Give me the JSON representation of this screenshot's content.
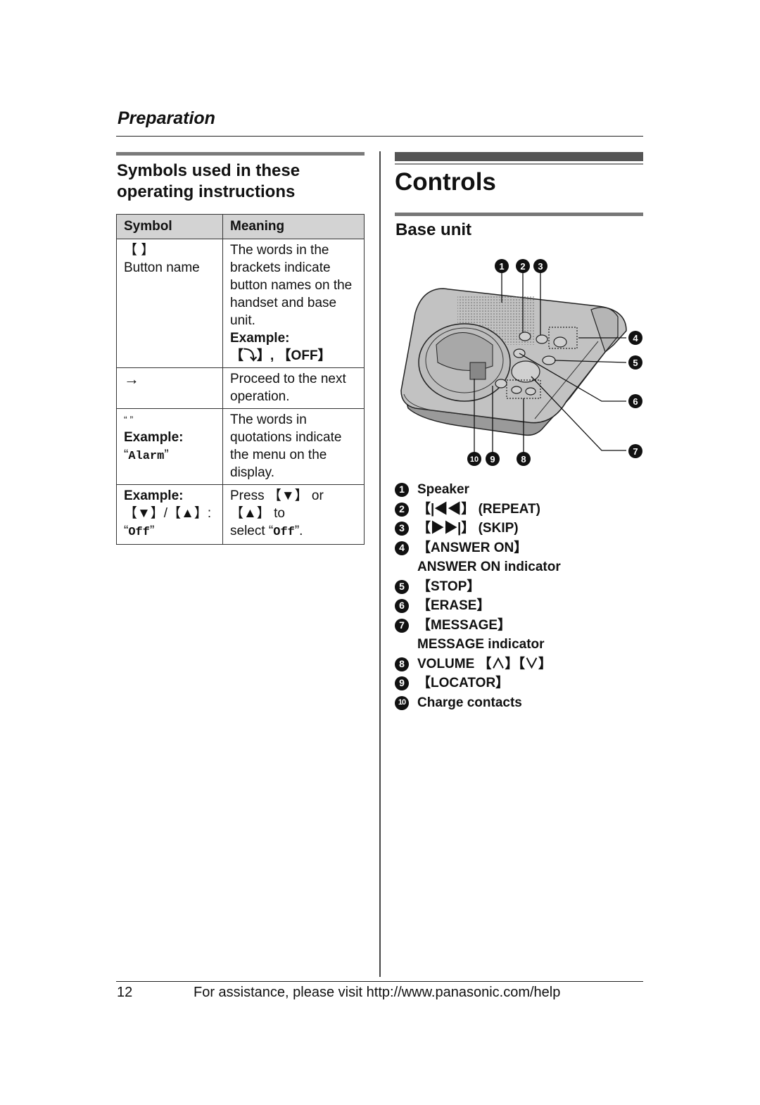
{
  "header": {
    "section_title": "Preparation"
  },
  "left": {
    "heading": "Symbols used in these operating instructions",
    "table": {
      "columns": [
        "Symbol",
        "Meaning"
      ],
      "rows": [
        {
          "symbol_lines": [
            "【 】",
            "Button name"
          ],
          "meaning_lines": [
            "The words in the",
            "brackets indicate",
            "button names on the",
            "handset and base",
            "unit."
          ],
          "example_label": "Example:",
          "example_value": "【⤵】, 【OFF】"
        },
        {
          "symbol": "→",
          "meaning_lines": [
            "Proceed to the next",
            "operation."
          ]
        },
        {
          "symbol": "“ ”",
          "symbol_example_label": "Example:",
          "symbol_example_value": "Alarm",
          "meaning_lines": [
            "The words in",
            "quotations indicate",
            "the menu on the",
            "display."
          ]
        },
        {
          "symbol_example_label": "Example:",
          "symbol_prefix": "【▼】/【▲】: “",
          "symbol_value": "Off",
          "symbol_suffix": "”",
          "meaning_prefix": "Press 【▼】 or 【▲】 to",
          "meaning_line2_prefix": "select “",
          "meaning_value": "Off",
          "meaning_line2_suffix": "”."
        }
      ]
    }
  },
  "right": {
    "heading": "Controls",
    "subheading": "Base unit",
    "figure": {
      "callouts": [
        "1",
        "2",
        "3",
        "4",
        "5",
        "6",
        "7",
        "8",
        "9",
        "10"
      ],
      "device_labels": {
        "repeat": "REPEAT",
        "skip": "SKIP",
        "erase": "ERASE",
        "stop": "STOP",
        "message": "MESSAGE",
        "locator": "LOCATOR",
        "volume": "VOLUME",
        "answer_on": "ANSWER ON"
      }
    },
    "legend": [
      {
        "num": "1",
        "lines": [
          "Speaker"
        ]
      },
      {
        "num": "2",
        "lines": [
          "【|◀◀】 (REPEAT)"
        ]
      },
      {
        "num": "3",
        "lines": [
          "【▶▶|】 (SKIP)"
        ]
      },
      {
        "num": "4",
        "lines": [
          "【ANSWER ON】",
          "ANSWER ON indicator"
        ]
      },
      {
        "num": "5",
        "lines": [
          "【STOP】"
        ]
      },
      {
        "num": "6",
        "lines": [
          "【ERASE】"
        ]
      },
      {
        "num": "7",
        "lines": [
          "【MESSAGE】",
          "MESSAGE indicator"
        ]
      },
      {
        "num": "8",
        "lines": [
          "VOLUME 【∧】【∨】"
        ]
      },
      {
        "num": "9",
        "lines": [
          "【LOCATOR】"
        ]
      },
      {
        "num": "10",
        "lines": [
          "Charge contacts"
        ]
      }
    ]
  },
  "footer": {
    "page_number": "12",
    "text": "For assistance, please visit http://www.panasonic.com/help"
  }
}
